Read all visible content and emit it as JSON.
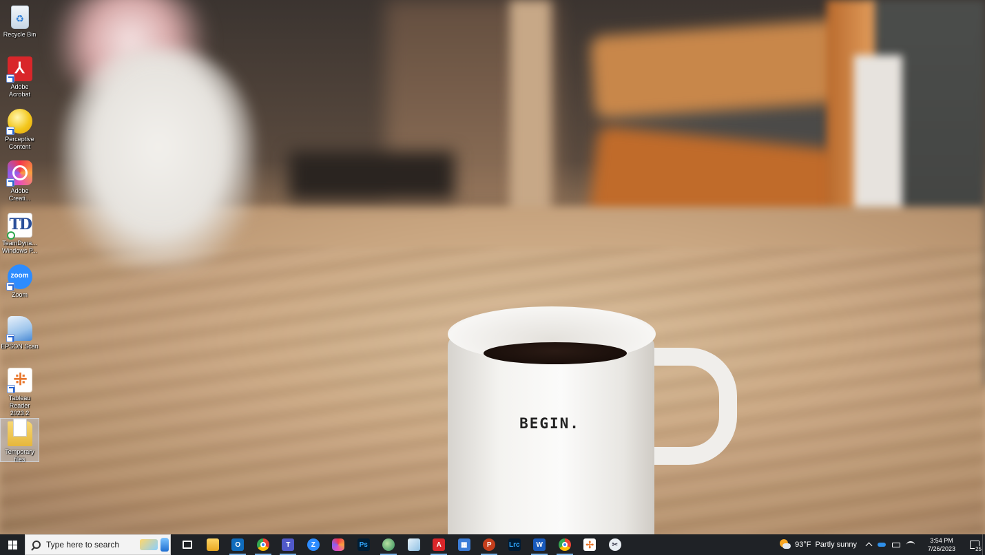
{
  "desktop": {
    "mug_text": "BEGIN.",
    "icons": [
      {
        "label": "Recycle Bin",
        "icon": "recycle-bin-icon"
      },
      {
        "label": "Adobe Acrobat",
        "icon": "adobe-acrobat-icon"
      },
      {
        "label": "Perceptive Content",
        "icon": "perceptive-content-icon"
      },
      {
        "label": "Adobe Creati...",
        "icon": "adobe-creative-cloud-icon"
      },
      {
        "label": "TeamDyna... Windows P...",
        "icon": "teamdynamix-icon"
      },
      {
        "label": "Zoom",
        "icon": "zoom-icon"
      },
      {
        "label": "EPSON Scan",
        "icon": "epson-scan-icon"
      },
      {
        "label": "Tableau Reader 2023.2",
        "icon": "tableau-reader-icon"
      },
      {
        "label": "Temporary files",
        "icon": "folder-icon"
      }
    ],
    "acrobat_glyph": "⅄",
    "td_glyph": "TD",
    "zoom_glyph": "zoom",
    "tableau_glyph": "⁜",
    "recycle_glyph": "♻"
  },
  "taskbar": {
    "search_placeholder": "Type here to search",
    "apps": [
      {
        "name": "task-view-button",
        "label": "",
        "running": false
      },
      {
        "name": "file-explorer-button",
        "label": "",
        "running": false
      },
      {
        "name": "outlook-button",
        "label": "O",
        "running": true
      },
      {
        "name": "chrome-button",
        "label": "",
        "running": true
      },
      {
        "name": "teams-button",
        "label": "T",
        "running": true
      },
      {
        "name": "zoom-button",
        "label": "Z",
        "running": false
      },
      {
        "name": "creative-cloud-button",
        "label": "",
        "running": false
      },
      {
        "name": "photoshop-button",
        "label": "Ps",
        "running": false
      },
      {
        "name": "globe-app-button",
        "label": "",
        "running": true
      },
      {
        "name": "app-cube-button",
        "label": "",
        "running": false
      },
      {
        "name": "acrobat-button",
        "label": "A",
        "running": true
      },
      {
        "name": "calculator-button",
        "label": "▦",
        "running": false
      },
      {
        "name": "powerpoint-button",
        "label": "P",
        "running": true
      },
      {
        "name": "lightroom-classic-button",
        "label": "Lrc",
        "running": false
      },
      {
        "name": "word-button",
        "label": "W",
        "running": true
      },
      {
        "name": "chrome-alt-button",
        "label": "",
        "running": true
      },
      {
        "name": "tableau-button",
        "label": "✢",
        "running": false
      },
      {
        "name": "snipping-tool-button",
        "label": "✂",
        "running": false
      }
    ],
    "weather": {
      "temp": "93°F",
      "condition": "Partly sunny"
    },
    "clock": {
      "time": "3:54 PM",
      "date": "7/26/2023"
    },
    "notification_count": "25"
  }
}
